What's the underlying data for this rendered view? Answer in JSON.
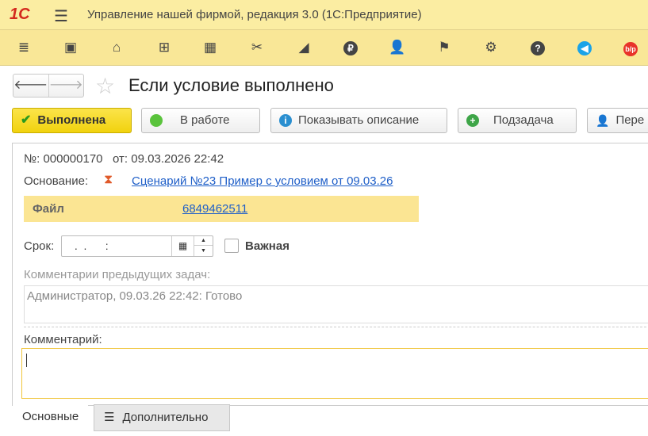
{
  "app": {
    "logo": "1С",
    "title": "Управление нашей фирмой, редакция 3.0  (1С:Предприятие)"
  },
  "toolbar": [
    "menu-icon",
    "contacts-icon",
    "basket-icon",
    "cart-icon",
    "grid-icon",
    "tools-icon",
    "factory-icon",
    "ruble-icon",
    "users-icon",
    "flag-icon",
    "gear-icon",
    "help-icon",
    "megaphone-icon",
    "bp-icon"
  ],
  "form": {
    "title": "Если условие выполнено"
  },
  "buttons": {
    "done": "Выполнена",
    "in_work": "В работе",
    "show_desc": "Показывать описание",
    "subtask": "Подзадача",
    "forward": "Пере"
  },
  "doc": {
    "num_label": "№:",
    "num": "000000170",
    "from_label": "от:",
    "date": "09.03.2026 22:42",
    "basis_label": "Основание:",
    "basis": "Сценарий №23 Пример с условием от 09.03.26",
    "file_label": "Файл",
    "file_value": "6849462511",
    "due_label": "Срок:",
    "due_value": " .  .      :",
    "important": "Важная",
    "prev_comments_label": "Комментарии предыдущих задач:",
    "prev_comments": "Администратор, 09.03.26 22:42: Готово",
    "comment_label": "Комментарий:",
    "comment": ""
  },
  "tabs": {
    "main": "Основные",
    "extra": "Дополнительно"
  }
}
